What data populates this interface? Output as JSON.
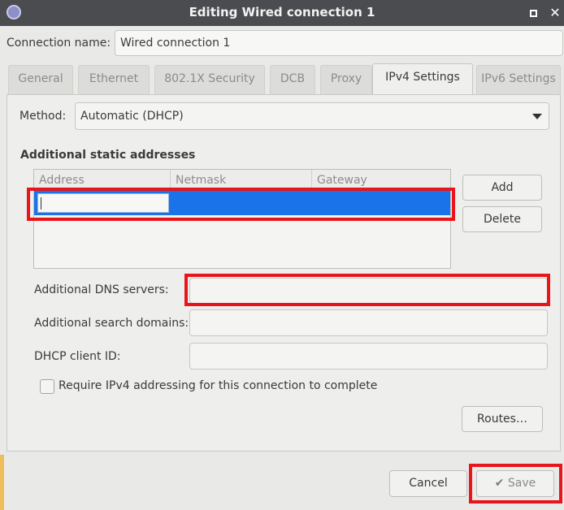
{
  "window": {
    "title": "Editing Wired connection 1",
    "maximize_icon": "maximize-icon",
    "close_glyph": "✕"
  },
  "connection_name": {
    "label": "Connection name:",
    "value": "Wired connection 1"
  },
  "tabs": [
    {
      "label": "General",
      "active": false
    },
    {
      "label": "Ethernet",
      "active": false
    },
    {
      "label": "802.1X Security",
      "active": false
    },
    {
      "label": "DCB",
      "active": false
    },
    {
      "label": "Proxy",
      "active": false
    },
    {
      "label": "IPv4 Settings",
      "active": true
    },
    {
      "label": "IPv6 Settings",
      "active": false
    }
  ],
  "ipv4": {
    "method_label": "Method:",
    "method_value": "Automatic (DHCP)",
    "static_heading": "Additional static addresses",
    "table": {
      "columns": [
        "Address",
        "Netmask",
        "Gateway"
      ],
      "rows": [
        {
          "address": "",
          "netmask": "",
          "gateway": "",
          "selected": true
        }
      ]
    },
    "add_label": "Add",
    "delete_label": "Delete",
    "dns_label": "Additional DNS servers:",
    "dns_value": "",
    "search_label": "Additional search domains:",
    "search_value": "",
    "dhcp_label": "DHCP client ID:",
    "dhcp_value": "",
    "require_label": "Require IPv4 addressing for this connection to complete",
    "require_checked": false,
    "routes_label": "Routes…"
  },
  "footer": {
    "cancel_label": "Cancel",
    "save_label": "Save",
    "save_icon": "✔"
  },
  "colors": {
    "highlight": "#e8151b",
    "selection": "#1a73e8",
    "titlebar": "#4b4c4f"
  }
}
